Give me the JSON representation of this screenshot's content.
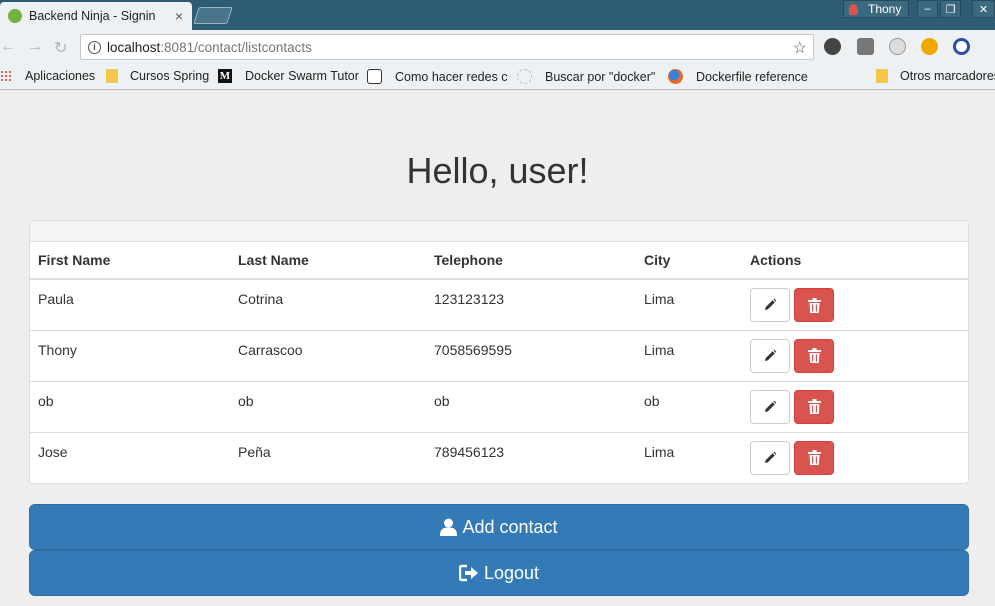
{
  "browser": {
    "tab_title": "Backend Ninja - Signin",
    "tab_close": "×",
    "profile_name": "Thony",
    "window_buttons": [
      "–",
      "❐",
      "✕"
    ],
    "url_host": "localhost",
    "url_path": ":8081/contact/listcontacts",
    "bookmarks": [
      "Aplicaciones",
      "Cursos Spring",
      "Docker Swarm Tutor",
      "Como hacer redes c",
      "Buscar por \"docker\"",
      "Dockerfile reference",
      "Otros marcadores"
    ]
  },
  "page": {
    "heading": "Hello, user!",
    "table": {
      "columns": [
        "First Name",
        "Last Name",
        "Telephone",
        "City",
        "Actions"
      ],
      "rows": [
        [
          "Paula",
          "Cotrina",
          "123123123",
          "Lima"
        ],
        [
          "Thony",
          "Carrascoo",
          "7058569595",
          "Lima"
        ],
        [
          "ob",
          "ob",
          "ob",
          "ob"
        ],
        [
          "Jose",
          "Peña",
          "789456123",
          "Lima"
        ]
      ]
    },
    "add_contact_label": "Add contact",
    "logout_label": "Logout"
  },
  "colors": {
    "primary": "#337ab7",
    "danger": "#d9534f",
    "titlebar": "#2e5d73"
  }
}
